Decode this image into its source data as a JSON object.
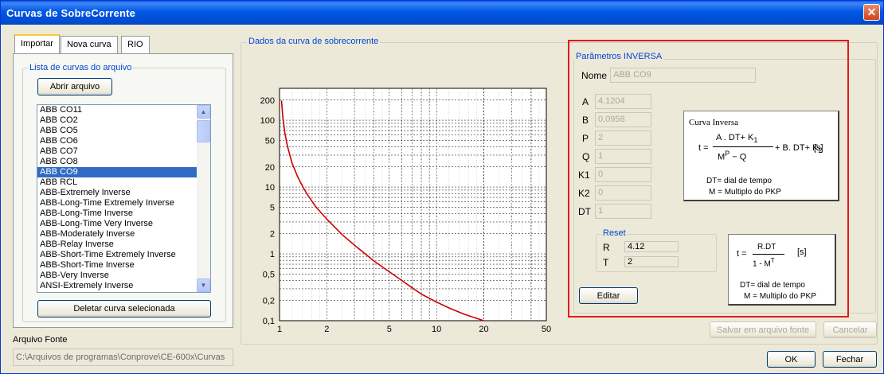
{
  "window": {
    "title": "Curvas de SobreCorrente"
  },
  "tabs": [
    {
      "label": "Importar",
      "active": true
    },
    {
      "label": "Nova curva",
      "active": false
    },
    {
      "label": "RIO",
      "active": false
    }
  ],
  "curve_list": {
    "group_label": "Lista de curvas do arquivo",
    "open_button": "Abrir arquivo",
    "items": [
      "ABB CO11",
      "ABB CO2",
      "ABB CO5",
      "ABB CO6",
      "ABB CO7",
      "ABB CO8",
      "ABB CO9",
      "ABB RCL",
      "ABB-Extremely Inverse",
      "ABB-Long-Time Extremely Inverse",
      "ABB-Long-Time Inverse",
      "ABB-Long-Time Very Inverse",
      "ABB-Moderately Inverse",
      "ABB-Relay Inverse",
      "ABB-Short-Time Extremely Inverse",
      "ABB-Short-Time Inverse",
      "ABB-Very Inverse",
      "ANSI-Extremely Inverse"
    ],
    "selected_index": 6,
    "delete_button": "Deletar curva selecionada"
  },
  "source_file": {
    "label": "Arquivo Fonte",
    "path": "C:\\Arquivos de programas\\Conprove\\CE-600x\\Curvas"
  },
  "chart_group_label": "Dados da curva de sobrecorrente",
  "chart_data": {
    "type": "line",
    "x_scale": "log",
    "y_scale": "log",
    "xlim": [
      1,
      50
    ],
    "ylim": [
      0.1,
      300
    ],
    "x_ticks": [
      "1",
      "2",
      "5",
      "10",
      "20",
      "50"
    ],
    "y_ticks": [
      "0,1",
      "0,2",
      "0,5",
      "1",
      "2",
      "5",
      "10",
      "20",
      "50",
      "100",
      "200"
    ],
    "grid": true,
    "series": [
      {
        "color": "#cc0000",
        "points": [
          [
            1.03,
            197
          ],
          [
            1.05,
            109
          ],
          [
            1.08,
            65
          ],
          [
            1.12,
            42
          ],
          [
            1.2,
            23
          ],
          [
            1.3,
            14.5
          ],
          [
            1.4,
            10.3
          ],
          [
            1.5,
            7.8
          ],
          [
            1.7,
            5.1
          ],
          [
            2.0,
            3.3
          ],
          [
            2.5,
            1.95
          ],
          [
            3.0,
            1.35
          ],
          [
            4.0,
            0.78
          ],
          [
            5.0,
            0.54
          ],
          [
            6.0,
            0.4
          ],
          [
            7.0,
            0.31
          ],
          [
            8.0,
            0.25
          ],
          [
            10.0,
            0.19
          ],
          [
            12.0,
            0.155
          ],
          [
            15.0,
            0.125
          ],
          [
            20.0,
            0.1
          ]
        ]
      }
    ]
  },
  "params": {
    "group_label": "Parâmetros INVERSA",
    "name_label": "Nome",
    "name_value": "ABB CO9",
    "fields": [
      {
        "label": "A",
        "value": "4,1204"
      },
      {
        "label": "B",
        "value": "0,0958"
      },
      {
        "label": "P",
        "value": "2"
      },
      {
        "label": "Q",
        "value": "1"
      },
      {
        "label": "K1",
        "value": "0"
      },
      {
        "label": "K2",
        "value": "0"
      },
      {
        "label": "DT",
        "value": "1"
      }
    ],
    "reset": {
      "label": "Reset",
      "r_label": "R",
      "r_value": "4.12",
      "t_label": "T",
      "t_value": "2"
    },
    "edit_button": "Editar"
  },
  "formula_inverse": {
    "title": "Curva Inversa",
    "lhs": "t =",
    "numerator": "A . DT+ K",
    "numerator_sub": "1",
    "denominator": "M",
    "denominator_sup": "P",
    "denominator_rest": " − Q",
    "plus_term": "+ B. DT+ K",
    "plus_sub": "2",
    "unit": "[s]",
    "legend1": "DT= dial de tempo",
    "legend2": "M = Multiplo do PKP"
  },
  "formula_reset": {
    "lhs": "t =",
    "numerator": "R.DT",
    "denominator": "1 - M",
    "denominator_sup": "T",
    "unit": "[s]",
    "legend1": "DT= dial de tempo",
    "legend2": "M = Multiplo do PKP"
  },
  "footer": {
    "save_button": "Salvar em arquivo fonte",
    "cancel_button": "Cancelar",
    "ok_button": "OK",
    "close_button": "Fechar"
  }
}
